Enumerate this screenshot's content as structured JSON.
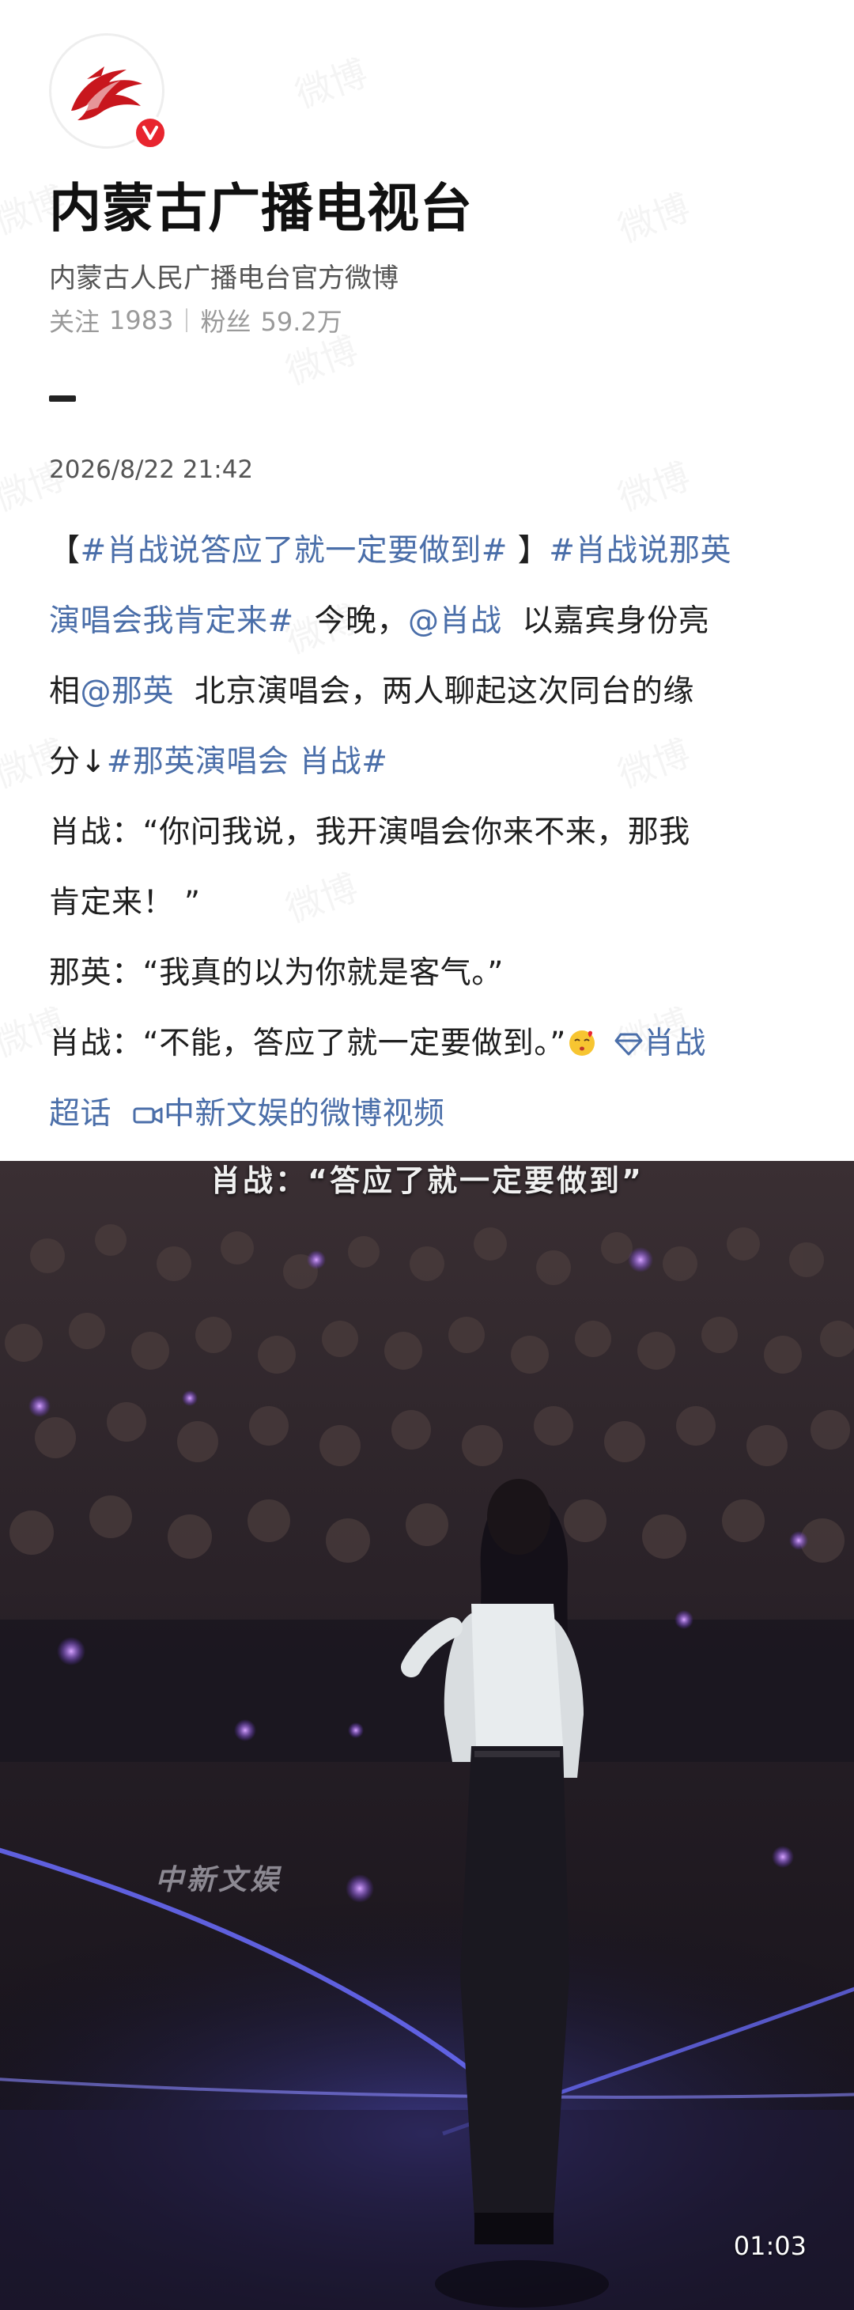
{
  "account": {
    "name": "内蒙古广播电视台",
    "description": "内蒙古人民广播电台官方微博",
    "following_label": "关注",
    "following_count": "1983",
    "followers_label": "粉丝",
    "followers_count": "59.2万",
    "verified": true
  },
  "watermark_text": "微博",
  "post": {
    "timestamp": "2026/8/22 21:42",
    "lines": [
      [
        "【",
        "#肖战说答应了就一定要做到#",
        " 】",
        "#肖战说那英"
      ],
      [
        "演唱会我肯定来#",
        "  今晚，",
        "@肖战",
        "  以嘉宾身份亮"
      ],
      [
        "相",
        "@那英",
        "  北京演唱会，两人聊起这次同台的缘"
      ],
      [
        "分↓",
        "#那英演唱会 肖战#"
      ],
      [
        "肖战：“你问我说，我开演唱会你来不来，那我"
      ],
      [
        "肯定来！ ”"
      ],
      [
        "那英：“我真的以为你就是客气。”"
      ],
      [
        "肖战：“不能，答应了就一定要做到。”"
      ],
      [
        "超话",
        " ",
        "中新文娱的微博视频"
      ]
    ],
    "supertopic_label": "肖战",
    "video_source_label": "中新文娱的微博视频"
  },
  "video": {
    "subtitle": "肖战：“答应了就一定要做到”",
    "logo_text": "中新文娱",
    "duration": "01:03"
  },
  "colors": {
    "link": "#4a6ea9",
    "verify_badge": "#e8252f",
    "stage_light": "#6b4cff"
  }
}
